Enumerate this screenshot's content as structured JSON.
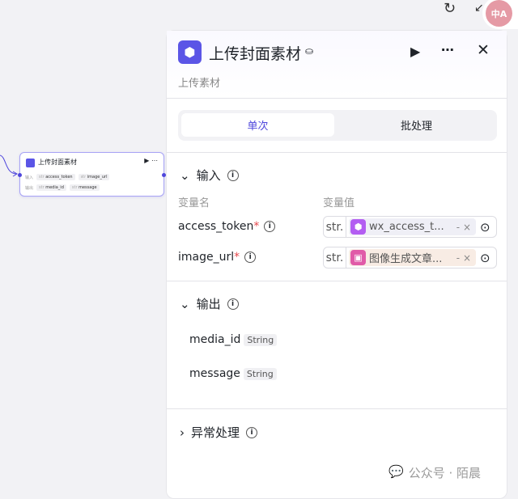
{
  "toolbar": {
    "refresh_icon": "refresh-icon",
    "shrink_icon": "shrink-icon",
    "translate_badge": "中A"
  },
  "node": {
    "title": "上传封面素材",
    "input_label": "输入",
    "output_label": "输出",
    "type_prefix": "str",
    "inputs": [
      "access_token",
      "image_url"
    ],
    "outputs": [
      "media_id",
      "message"
    ]
  },
  "panel": {
    "title": "上传封面素材",
    "subtitle": "上传素材",
    "tabs": [
      "单次",
      "批处理"
    ],
    "input_section": {
      "title": "输入",
      "col_name": "变量名",
      "col_value": "变量值",
      "params": [
        {
          "name": "access_token",
          "required": "*",
          "type": "str.",
          "ref": "wx_access_t...",
          "ref_color": "#b35df2",
          "ref_bg": "#efeff6"
        },
        {
          "name": "image_url",
          "required": "*",
          "type": "str.",
          "ref": "图像生成文章...",
          "ref_color": "#e05aa8",
          "ref_bg": "#f8ece4"
        }
      ]
    },
    "output_section": {
      "title": "输出",
      "items": [
        {
          "name": "media_id",
          "type": "String"
        },
        {
          "name": "message",
          "type": "String"
        }
      ]
    },
    "error_section": {
      "title": "异常处理"
    }
  },
  "watermark": "公众号 · 陌晨",
  "accent": "#5b55e6"
}
